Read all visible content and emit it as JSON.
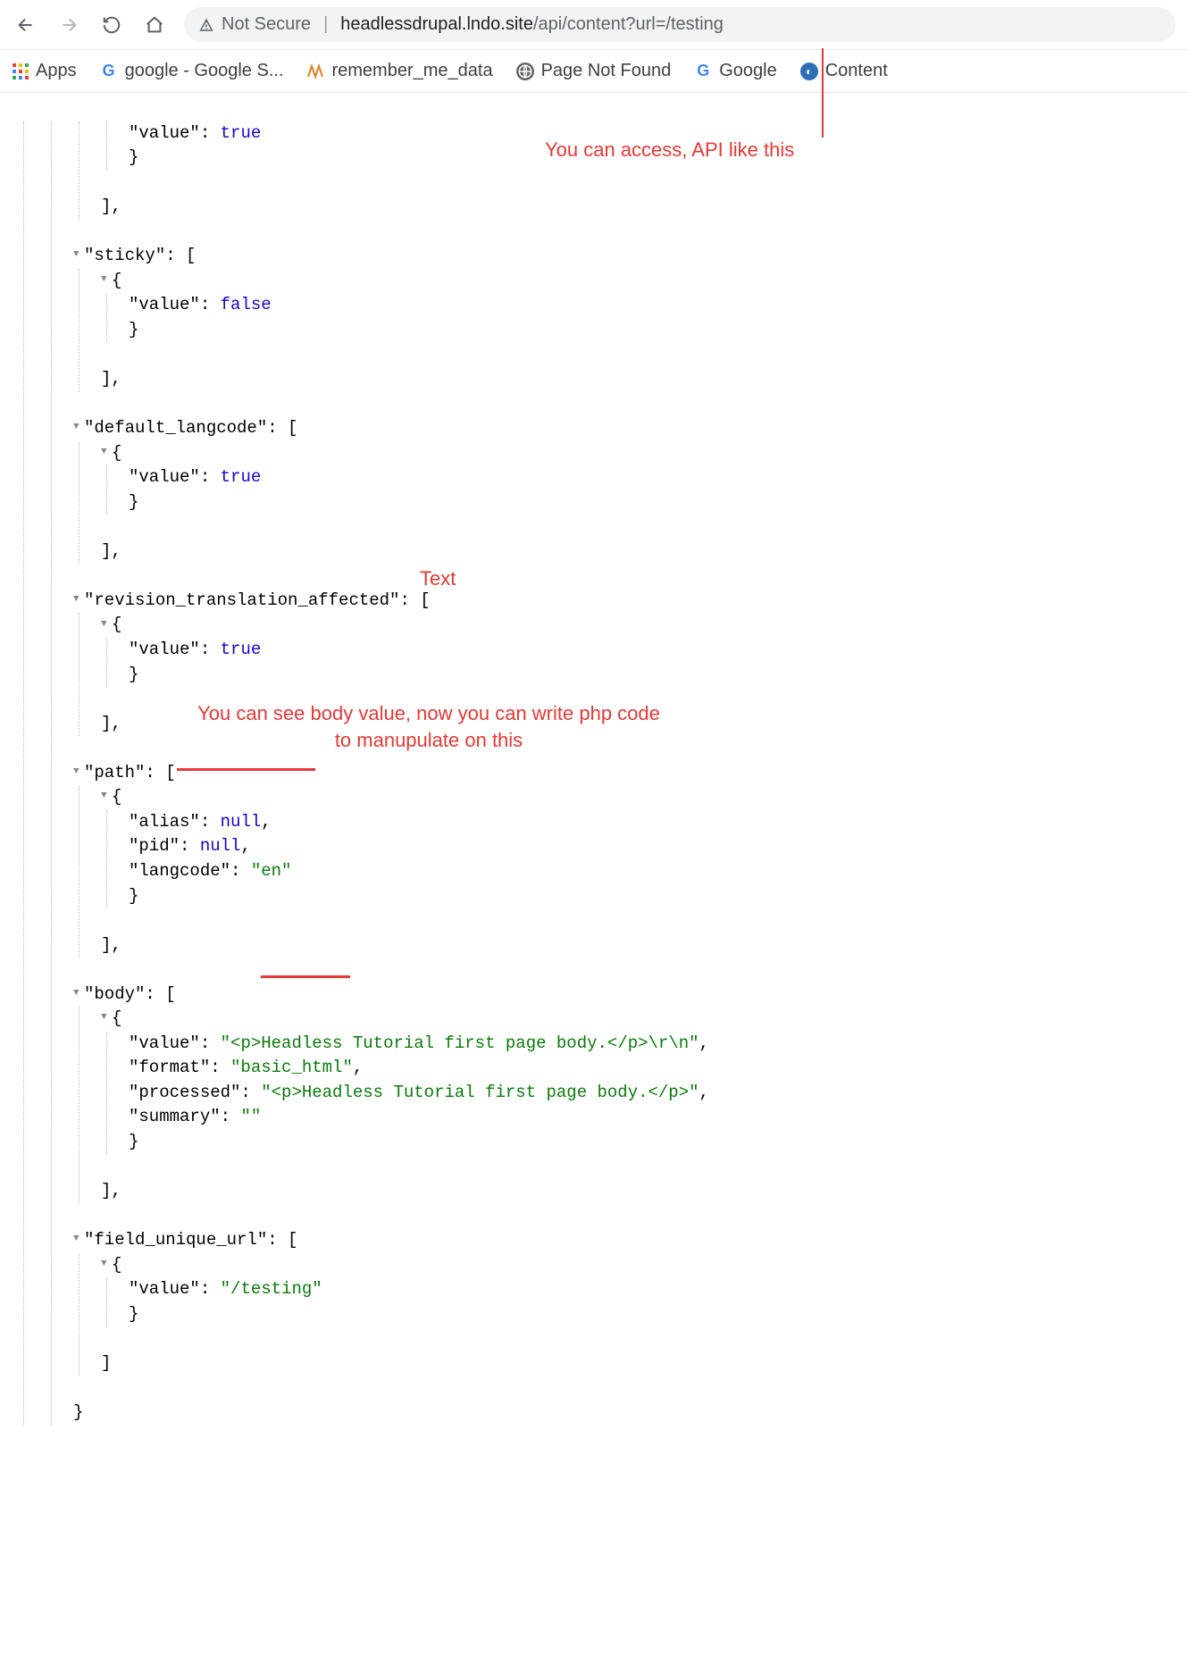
{
  "toolbar": {
    "secure_label": "Not Secure",
    "url_host": "headlessdrupal.lndo.site",
    "url_path": "/api/content?url=/testing"
  },
  "bookmarks": {
    "apps": "Apps",
    "items": [
      {
        "icon": "g",
        "label": "google - Google S..."
      },
      {
        "icon": "pma",
        "label": "remember_me_data"
      },
      {
        "icon": "globe",
        "label": "Page Not Found"
      },
      {
        "icon": "g",
        "label": "Google"
      },
      {
        "icon": "content",
        "label": "Content"
      }
    ]
  },
  "json": {
    "line1_key": "\"value\"",
    "line1_val": "true",
    "sticky_key": "\"sticky\"",
    "sticky_value_key": "\"value\"",
    "sticky_value_val": "false",
    "default_langcode_key": "\"default_langcode\"",
    "dl_value_key": "\"value\"",
    "dl_value_val": "true",
    "rta_key": "\"revision_translation_affected\"",
    "rta_value_key": "\"value\"",
    "rta_value_val": "true",
    "path_key": "\"path\"",
    "path_alias_key": "\"alias\"",
    "path_alias_val": "null",
    "path_pid_key": "\"pid\"",
    "path_pid_val": "null",
    "path_lang_key": "\"langcode\"",
    "path_lang_val": "\"en\"",
    "body_key": "\"body\"",
    "body_value_key": "\"value\"",
    "body_value_val": "\"<p>Headless Tutorial first page body.</p>\\r\\n\"",
    "body_format_key": "\"format\"",
    "body_format_val": "\"basic_html\"",
    "body_processed_key": "\"processed\"",
    "body_processed_val": "\"<p>Headless Tutorial first page body.</p>\"",
    "body_summary_key": "\"summary\"",
    "body_summary_val": "\"\"",
    "fuu_key": "\"field_unique_url\"",
    "fuu_value_key": "\"value\"",
    "fuu_value_val": "\"/testing\""
  },
  "annotations": {
    "top": "You can access, API like this",
    "mid": "Text",
    "body": "You can see body value, now you\ncan write php code to manupulate on this"
  }
}
